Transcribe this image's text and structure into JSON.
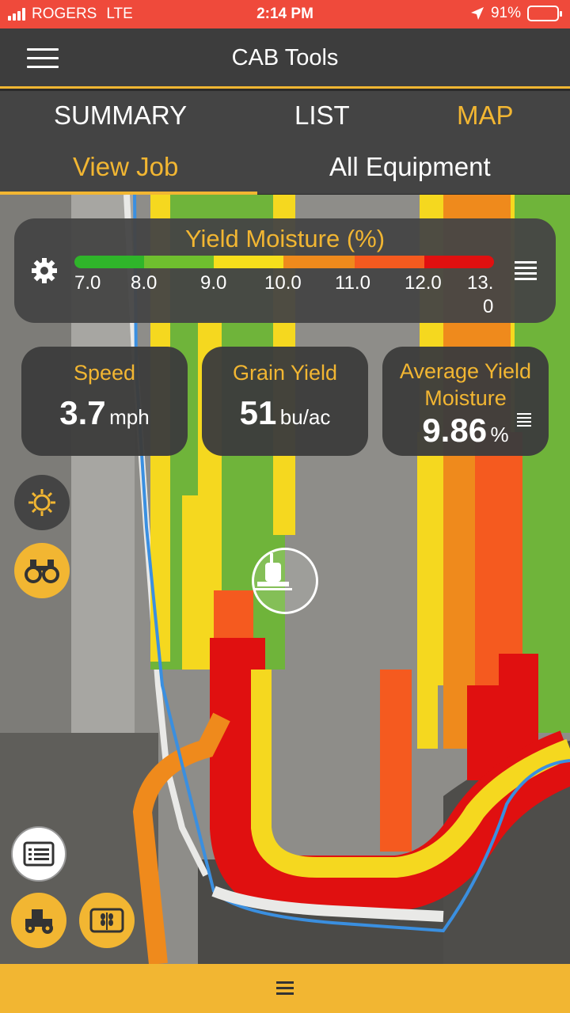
{
  "status_bar": {
    "carrier": "ROGERS",
    "network": "LTE",
    "time": "2:14 PM",
    "battery": "91%",
    "battery_level": 0.91
  },
  "app_bar": {
    "title": "CAB Tools",
    "menu_icon": "hamburger-icon"
  },
  "tabs": [
    {
      "label": "SUMMARY",
      "active": false
    },
    {
      "label": "LIST",
      "active": false
    },
    {
      "label": "MAP",
      "active": true
    }
  ],
  "subtabs": [
    {
      "label": "View Job",
      "active": true
    },
    {
      "label": "All Equipment",
      "active": false
    }
  ],
  "legend": {
    "title": "Yield Moisture (%)",
    "ticks": [
      "7.0",
      "8.0",
      "9.0",
      "10.0",
      "11.0",
      "12.0",
      "13.",
      "0"
    ],
    "colors": [
      "#2fb52a",
      "#6fbf2e",
      "#f6df1b",
      "#ef8a1c",
      "#f55a1f",
      "#e01010"
    ]
  },
  "stats": {
    "speed": {
      "label": "Speed",
      "value": "3.7",
      "unit": "mph"
    },
    "grain_yield": {
      "label": "Grain Yield",
      "value": "51",
      "unit": "bu/ac"
    },
    "avg_moisture": {
      "label": "Average Yield Moisture",
      "value": "9.86",
      "unit": "%"
    }
  },
  "colors": {
    "accent": "#f2b632",
    "status_bar": "#ef4a3b",
    "header": "#3d3d3d",
    "boundary": "#3a8fe0"
  },
  "icons": {
    "sun": "sun-icon",
    "binoculars": "binoculars-icon",
    "notes": "notes-icon",
    "tractor": "tractor-icon",
    "wheat": "wheat-icon",
    "combine_marker": "combine-marker-icon",
    "bottom_menu": "menu-icon"
  }
}
